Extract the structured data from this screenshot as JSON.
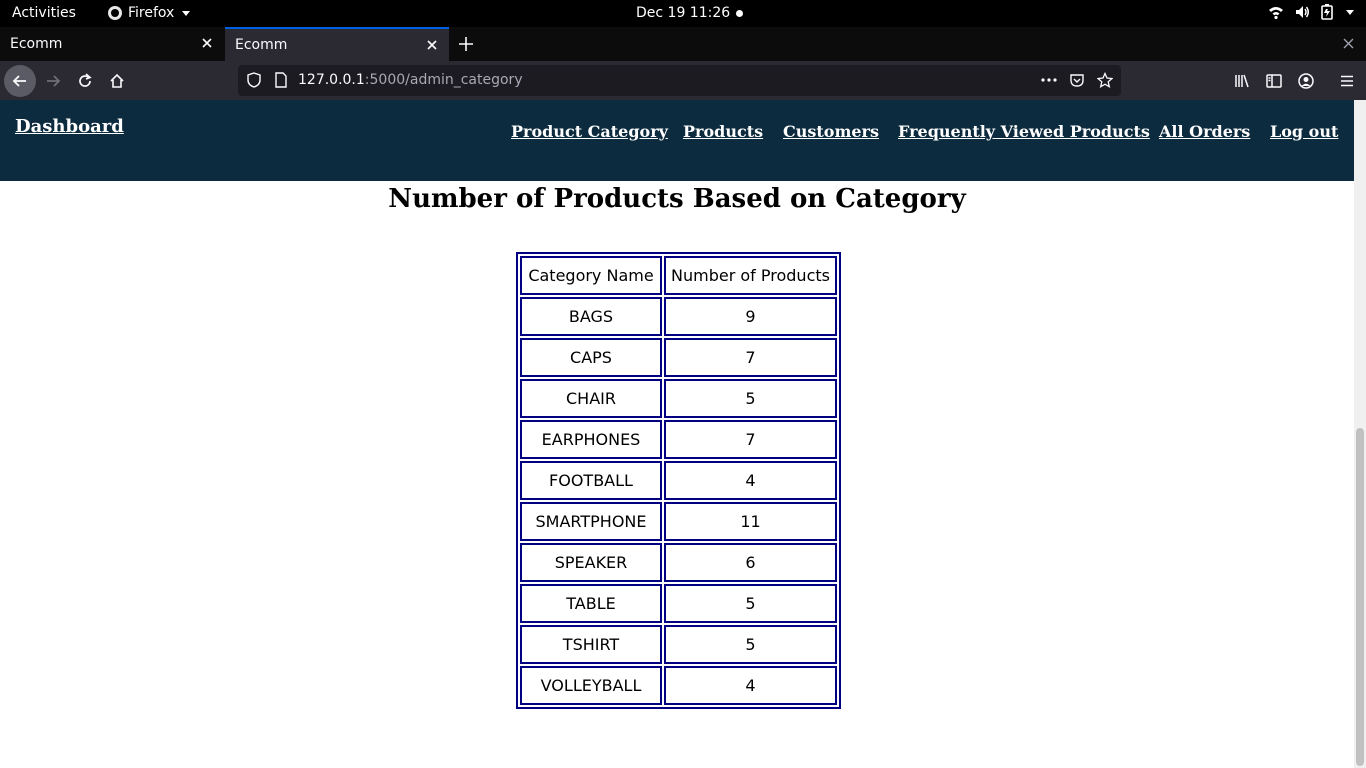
{
  "system_bar": {
    "activities": "Activities",
    "app_name": "Firefox",
    "datetime": "Dec 19  11:26"
  },
  "tabs": [
    {
      "title": "Ecomm",
      "active": false
    },
    {
      "title": "Ecomm",
      "active": true
    }
  ],
  "urlbar": {
    "host": "127.0.0.1",
    "path": ":5000/admin_category"
  },
  "site_nav": {
    "brand": "Dashboard",
    "links": [
      "Product Category",
      "Products",
      "Customers",
      "Frequently Viewed Products",
      "All Orders",
      "Log out"
    ]
  },
  "heading": "Number of Products Based on Category",
  "table": {
    "headers": [
      "Category Name",
      "Number of Products"
    ],
    "rows": [
      [
        "BAGS",
        "9"
      ],
      [
        "CAPS",
        "7"
      ],
      [
        "CHAIR",
        "5"
      ],
      [
        "EARPHONES",
        "7"
      ],
      [
        "FOOTBALL",
        "4"
      ],
      [
        "SMARTPHONE",
        "11"
      ],
      [
        "SPEAKER",
        "6"
      ],
      [
        "TABLE",
        "5"
      ],
      [
        "TSHIRT",
        "5"
      ],
      [
        "VOLLEYBALL",
        "4"
      ]
    ]
  },
  "colors": {
    "nav_background": "#0d2b3e",
    "table_border": "#000080",
    "active_tab_accent": "#0060df"
  }
}
